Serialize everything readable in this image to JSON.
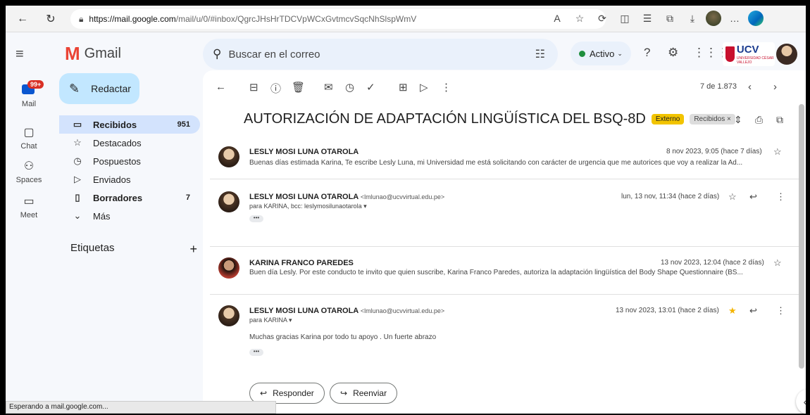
{
  "browser": {
    "url_host": "https://mail.google.com",
    "url_path": "/mail/u/0/#inbox/QgrcJHsHrTDCVpWCxGvtmcvSqcNhSlspWmV",
    "status_text": "Esperando a mail.google.com..."
  },
  "gmail": {
    "logo_text": "Gmail",
    "search_placeholder": "Buscar en el correo",
    "status_label": "Activo",
    "ucv_text": "UCV",
    "ucv_sub": "UNIVERSIDAD CÉSAR VALLEJO"
  },
  "rail": {
    "mail_badge": "99+",
    "items": [
      "Mail",
      "Chat",
      "Spaces",
      "Meet"
    ]
  },
  "compose_label": "Redactar",
  "folders": [
    {
      "label": "Recibidos",
      "count": "951",
      "icon": "inbox-icon"
    },
    {
      "label": "Destacados",
      "count": "",
      "icon": "star-icon"
    },
    {
      "label": "Pospuestos",
      "count": "",
      "icon": "clock-icon"
    },
    {
      "label": "Enviados",
      "count": "",
      "icon": "send-icon"
    },
    {
      "label": "Borradores",
      "count": "7",
      "icon": "draft-icon"
    },
    {
      "label": "Más",
      "count": "",
      "icon": "chevron-down-icon"
    }
  ],
  "labels_title": "Etiquetas",
  "thread": {
    "page_info": "7 de 1.873",
    "subject": "AUTORIZACIÓN DE ADAPTACIÓN LINGÜÍSTICA DEL BSQ-8D",
    "tag_external": "Externo",
    "tag_inbox": "Recibidos ×",
    "messages": [
      {
        "sender": "LESLY MOSI LUNA OTAROLA",
        "email": "",
        "date": "8 nov 2023, 9:05 (hace 7 días)",
        "snippet": "Buenas días estimada Karina, Te escribe Lesly Luna, mi Universidad me está solicitando con carácter de urgencia que me autorices que voy a realizar la Ad...",
        "to": "",
        "starred": false
      },
      {
        "sender": "LESLY MOSI LUNA OTAROLA",
        "email": "<lmlunao@ucvvirtual.edu.pe>",
        "date": "lun, 13 nov, 11:34 (hace 2 días)",
        "snippet": "",
        "to": "para KARINA, bcc: leslymosilunaotarola ▾",
        "starred": false
      },
      {
        "sender": "KARINA FRANCO PAREDES",
        "email": "",
        "date": "13 nov 2023, 12:04 (hace 2 días)",
        "snippet": "Buen día Lesly. Por este conducto te invito que quien suscribe, Karina Franco Paredes, autoriza la adaptación lingüística del Body Shape Questionnaire (BS...",
        "to": "",
        "starred": false
      },
      {
        "sender": "LESLY MOSI LUNA OTAROLA",
        "email": "<lmlunao@ucvvirtual.edu.pe>",
        "date": "13 nov 2023, 13:01 (hace 2 días)",
        "snippet": "",
        "to": "para KARINA ▾",
        "body": "Muchas gracias Karina por todo tu apoyo . Un fuerte abrazo",
        "starred": true
      }
    ],
    "reply_label": "Responder",
    "forward_label": "Reenviar"
  },
  "dots": "•••"
}
